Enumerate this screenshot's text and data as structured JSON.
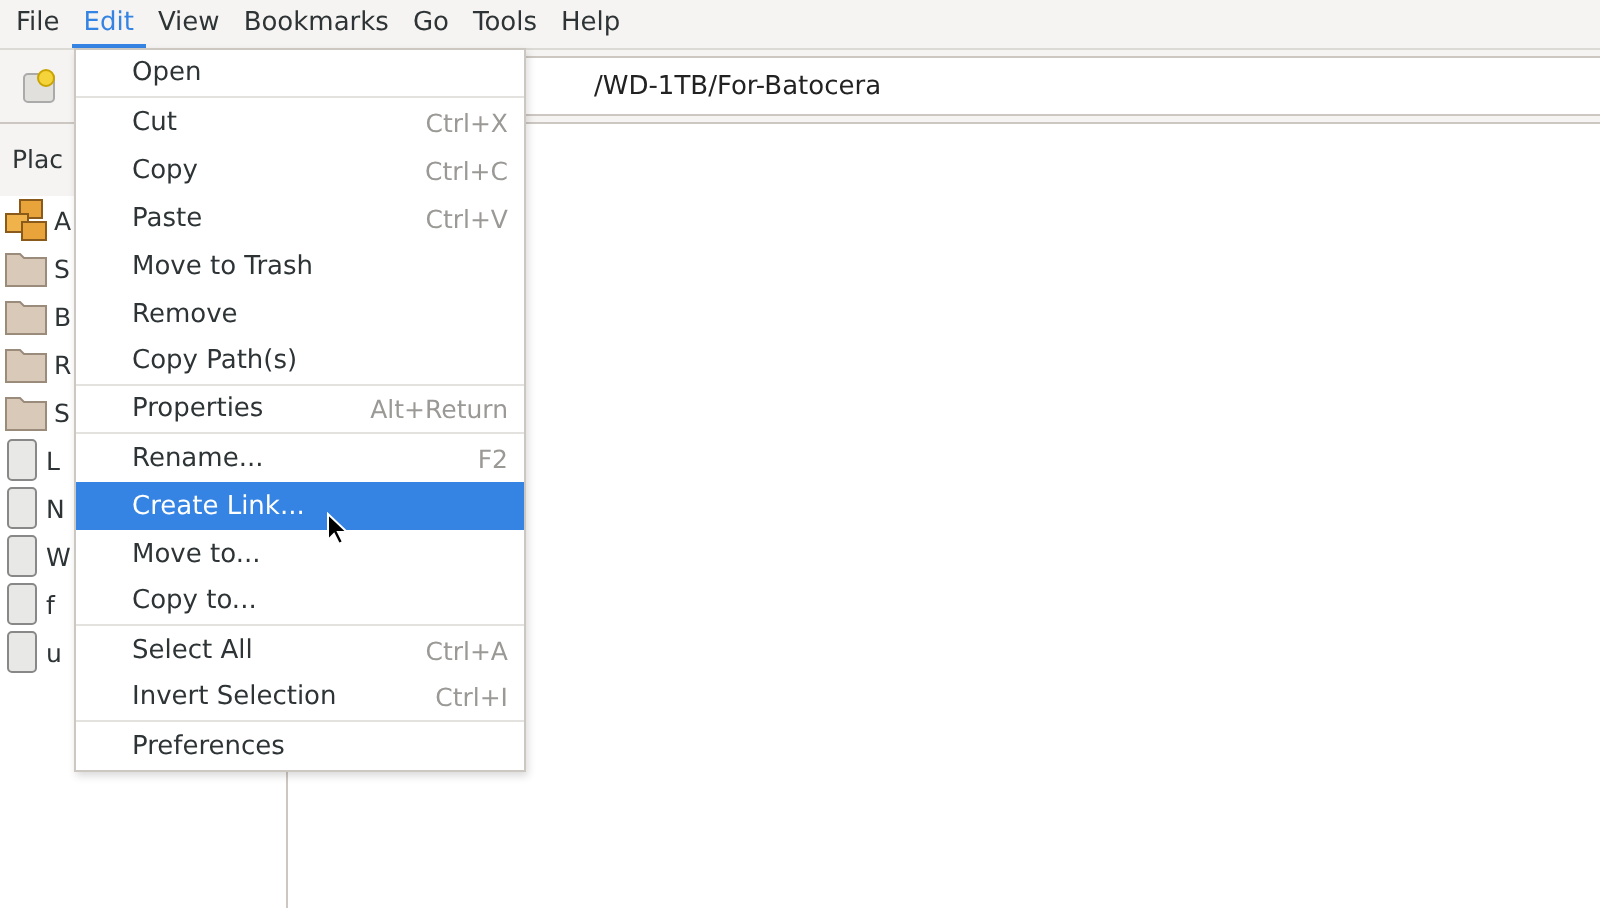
{
  "menubar": [
    {
      "label": "File",
      "selected": false
    },
    {
      "label": "Edit",
      "selected": true
    },
    {
      "label": "View",
      "selected": false
    },
    {
      "label": "Bookmarks",
      "selected": false
    },
    {
      "label": "Go",
      "selected": false
    },
    {
      "label": "Tools",
      "selected": false
    },
    {
      "label": "Help",
      "selected": false
    }
  ],
  "location": {
    "value": "/WD-1TB/For-Batocera"
  },
  "sidebar": {
    "heading": "Plac",
    "items": [
      {
        "label": "A",
        "kind": "apps"
      },
      {
        "label": "S",
        "kind": "folder"
      },
      {
        "label": "B",
        "kind": "folder"
      },
      {
        "label": "R",
        "kind": "folder"
      },
      {
        "label": "S",
        "kind": "folder"
      },
      {
        "label": "L",
        "kind": "drive"
      },
      {
        "label": "N",
        "kind": "drive"
      },
      {
        "label": "W",
        "kind": "drive"
      },
      {
        "label": "f",
        "kind": "drive"
      },
      {
        "label": "u",
        "kind": "drive"
      }
    ]
  },
  "menu": {
    "items": [
      {
        "label": "Open",
        "selected": false,
        "separator_after": true
      },
      {
        "label": "Cut",
        "shortcut": "Ctrl+X",
        "selected": false
      },
      {
        "label": "Copy",
        "shortcut": "Ctrl+C",
        "selected": false
      },
      {
        "label": "Paste",
        "shortcut": "Ctrl+V",
        "selected": false
      },
      {
        "label": "Move to Trash",
        "selected": false
      },
      {
        "label": "Remove",
        "selected": false
      },
      {
        "label": "Copy Path(s)",
        "selected": false,
        "separator_after": true
      },
      {
        "label": "Properties",
        "shortcut": "Alt+Return",
        "selected": false,
        "separator_after": true
      },
      {
        "label": "Rename...",
        "shortcut": "F2",
        "selected": false
      },
      {
        "label": "Create Link...",
        "selected": true
      },
      {
        "label": "Move to...",
        "selected": false
      },
      {
        "label": "Copy to...",
        "selected": false,
        "separator_after": true
      },
      {
        "label": "Select All",
        "shortcut": "Ctrl+A",
        "selected": false
      },
      {
        "label": "Invert Selection",
        "shortcut": "Ctrl+I",
        "selected": false,
        "separator_after": true
      },
      {
        "label": "Preferences",
        "selected": false
      }
    ]
  }
}
